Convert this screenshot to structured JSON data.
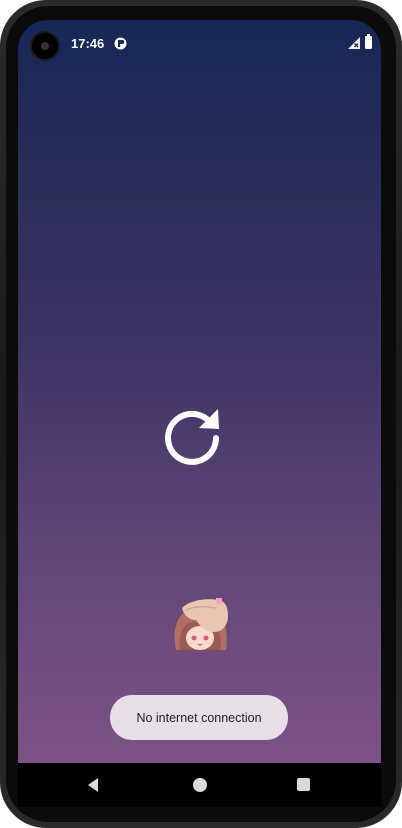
{
  "status_bar": {
    "time": "17:46",
    "app_icon": "app-notification-icon",
    "signal_icon": "signal-no-service-icon",
    "battery_icon": "battery-icon"
  },
  "main": {
    "reload_icon": "refresh-icon",
    "mascot_image": "anime-character-image"
  },
  "toast": {
    "message": "No internet connection"
  },
  "nav_bar": {
    "back_icon": "back-icon",
    "home_icon": "home-icon",
    "recents_icon": "recents-icon"
  },
  "colors": {
    "gradient_top": "#152757",
    "gradient_bottom": "#7d5286",
    "toast_bg": "#e6e0e6"
  }
}
